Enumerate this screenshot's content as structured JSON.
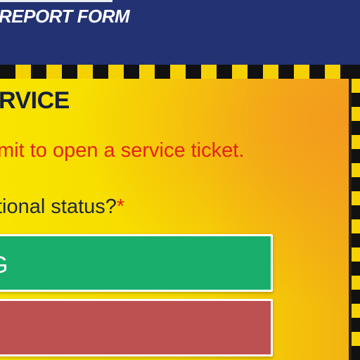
{
  "header": {
    "title": "REPORT FORM"
  },
  "section": {
    "title": "RVICE"
  },
  "instruction": {
    "text": "mit to open a service ticket."
  },
  "question": {
    "text": "tional status?",
    "required_mark": "*"
  },
  "options": [
    {
      "label": "G",
      "color": "#19ae6c"
    },
    {
      "label": "",
      "color": "#bd5050"
    }
  ],
  "colors": {
    "header_bg": "#233272",
    "panel_yellow": "#f8e400",
    "panel_orange": "#f39a1f",
    "hazard_black": "#111111",
    "hazard_yellow": "#f5d100",
    "instruction_red": "#e1231b"
  }
}
